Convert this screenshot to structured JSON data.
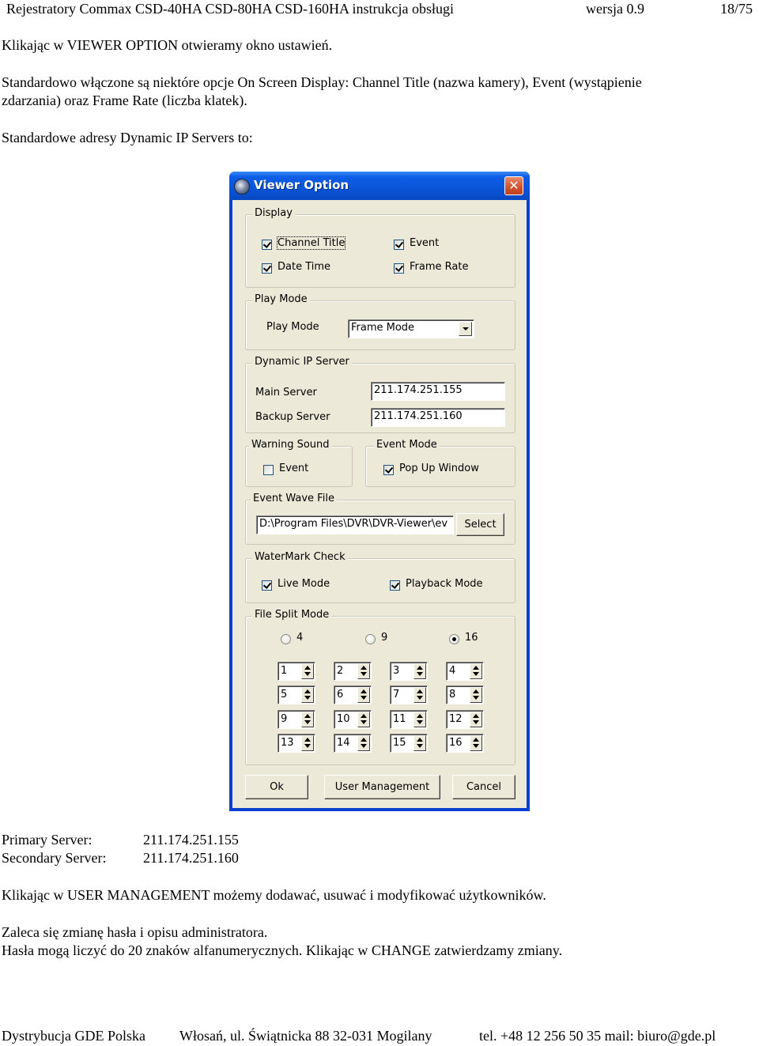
{
  "header": {
    "doc_title": "Rejestratory Commax CSD-40HA CSD-80HA CSD-160HA instrukcja obsługi",
    "version": "wersja 0.9",
    "page": "18/75"
  },
  "body_top": {
    "p1": "Klikając w VIEWER OPTION otwieramy okno ustawień.",
    "p2_line1": "Standardowo włączone są niektóre opcje On Screen  Display: Channel Title (nazwa kamery), Event (wystąpienie",
    "p2_line2": "zdarzania) oraz Frame Rate (liczba klatek).",
    "p3": "Standardowe adresy Dynamic IP Servers to:"
  },
  "dialog": {
    "title": "Viewer Option",
    "close_icon": "close-icon",
    "display": {
      "legend": "Display",
      "options": [
        {
          "label": "Channel Title",
          "checked": true
        },
        {
          "label": "Event",
          "checked": true
        },
        {
          "label": "Date Time",
          "checked": true
        },
        {
          "label": "Frame Rate",
          "checked": true
        }
      ]
    },
    "play_mode": {
      "legend": "Play Mode",
      "label": "Play Mode",
      "selected": "Frame Mode"
    },
    "dynamic_ip": {
      "legend": "Dynamic IP Server",
      "main_label": "Main Server",
      "main_value": "211.174.251.155",
      "backup_label": "Backup Server",
      "backup_value": "211.174.251.160"
    },
    "warning_sound": {
      "legend": "Warning Sound",
      "event_label": "Event",
      "event_checked": false
    },
    "event_mode": {
      "legend": "Event Mode",
      "popup_label": "Pop Up Window",
      "popup_checked": true
    },
    "event_wave_file": {
      "legend": "Event Wave File",
      "path": "D:\\Program Files\\DVR\\DVR-Viewer\\ev",
      "select_label": "Select"
    },
    "watermark": {
      "legend": "WaterMark Check",
      "live_label": "Live Mode",
      "live_checked": true,
      "playback_label": "Playback Mode",
      "playback_checked": true
    },
    "file_split": {
      "legend": "File Split Mode",
      "radios": [
        {
          "label": "4",
          "checked": false
        },
        {
          "label": "9",
          "checked": false
        },
        {
          "label": "16",
          "checked": true
        }
      ],
      "spinners": [
        "1",
        "2",
        "3",
        "4",
        "5",
        "6",
        "7",
        "8",
        "9",
        "10",
        "11",
        "12",
        "13",
        "14",
        "15",
        "16"
      ]
    },
    "buttons": {
      "ok": "Ok",
      "user_management": "User Management",
      "cancel": "Cancel"
    }
  },
  "body_bottom": {
    "primary_label": "Primary Server:",
    "primary_value": "211.174.251.155",
    "secondary_label": "Secondary Server:",
    "secondary_value": "211.174.251.160",
    "p4": "Klikając w USER MANAGEMENT możemy dodawać, usuwać i modyfikować użytkowników.",
    "p5_line1": "Zaleca się zmianę hasła i opisu administratora.",
    "p5_line2": "Hasła mogą liczyć do 20 znaków alfanumerycznych. Klikając w CHANGE zatwierdzamy zmiany."
  },
  "footer": {
    "company": "Dystrybucja GDE Polska",
    "address": "Włosań, ul. Świątnicka 88 32-031 Mogilany",
    "contact": "tel. +48 12 256 50 35 mail: biuro@gde.pl"
  }
}
